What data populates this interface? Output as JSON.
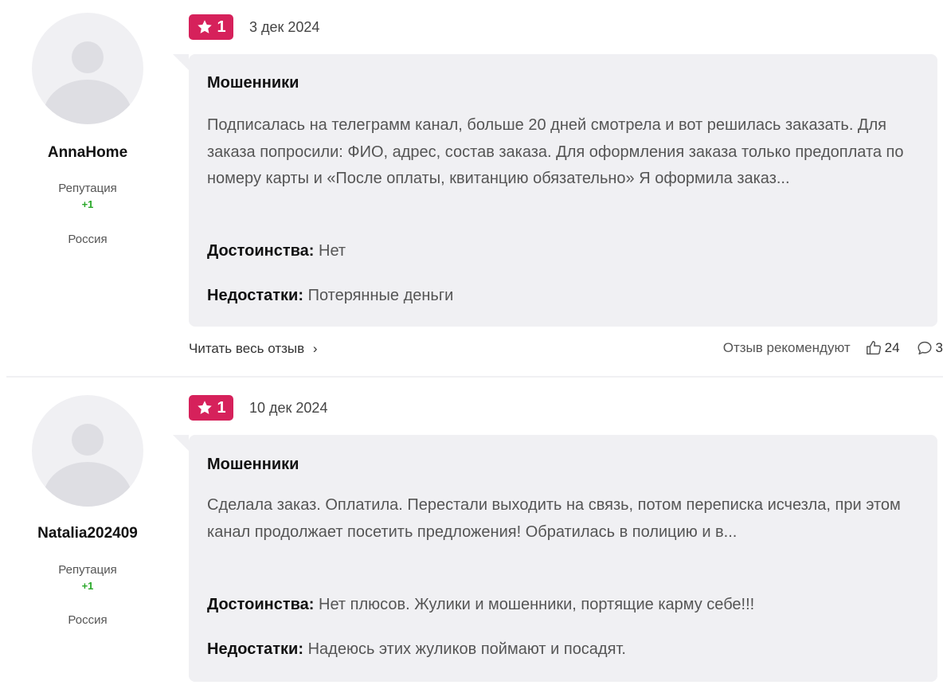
{
  "reviews": [
    {
      "username": "AnnaHome",
      "reputation_label": "Репутация",
      "reputation_value": "+1",
      "country": "Россия",
      "rating": "1",
      "date": "3 дек 2024",
      "title": "Мошенники",
      "text": "Подписалась на телеграмм канал, больше 20 дней смотрела и вот решилась заказать. Для заказа попросили: ФИО, адрес, состав заказа. Для оформления заказа только предоплата по номеру карты и «После оплаты, квитанцию обязательно» Я оформила заказ...",
      "pros_label": "Достоинства:",
      "pros": "Нет",
      "cons_label": "Недостатки:",
      "cons": "Потерянные деньги",
      "read_more": "Читать весь отзыв",
      "recommend_label": "Отзыв рекомендуют",
      "likes": "24",
      "comments": "3"
    },
    {
      "username": "Natalia202409",
      "reputation_label": "Репутация",
      "reputation_value": "+1",
      "country": "Россия",
      "rating": "1",
      "date": "10 дек 2024",
      "title": "Мошенники",
      "text": "Сделала заказ. Оплатила. Перестали выходить на связь, потом переписка исчезла, при этом канал продолжает посетить предложения! Обратилась в полицию и в...",
      "pros_label": "Достоинства:",
      "pros": "Нет плюсов. Жулики и мошенники, портящие карму себе!!!",
      "cons_label": "Недостатки:",
      "cons": "Надеюсь этих жуликов поймают и посадят."
    }
  ],
  "colors": {
    "rating_badge": "#d6215b",
    "bubble_bg": "#f0f0f3",
    "reputation_positive": "#2aa82a"
  },
  "icons": {
    "rating": "star-icon",
    "read_more": "chevron-right-icon",
    "likes": "thumbs-up-icon",
    "comments": "comment-icon"
  }
}
